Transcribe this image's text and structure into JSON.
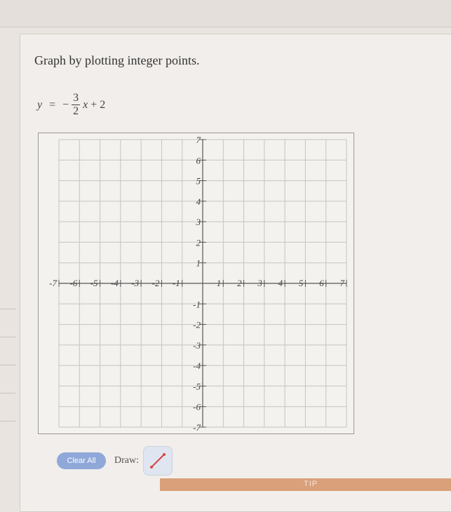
{
  "question": {
    "title": "Graph by plotting integer points.",
    "equation": {
      "lhs": "y",
      "equals": "=",
      "sign": "−",
      "numerator": "3",
      "denominator": "2",
      "variable": "x",
      "constant": "+ 2"
    }
  },
  "graph": {
    "x_ticks": [
      "-7",
      "-6",
      "-5",
      "-4",
      "-3",
      "-2",
      "-1",
      "1",
      "2",
      "3",
      "4",
      "5",
      "6",
      "7"
    ],
    "y_ticks": [
      "7",
      "6",
      "5",
      "4",
      "3",
      "2",
      "1",
      "-1",
      "-2",
      "-3",
      "-4",
      "-5",
      "-6",
      "-7"
    ],
    "range": {
      "xmin": -7,
      "xmax": 7,
      "ymin": -7,
      "ymax": 7
    },
    "grid": true
  },
  "controls": {
    "clear_all": "Clear All",
    "draw_label": "Draw:",
    "draw_tool_icon": "line-segment-icon"
  },
  "footer": {
    "tip": "TIP"
  },
  "colors": {
    "clear_button": "#8fa8d9",
    "tip_bar": "#d9a07a",
    "draw_tool_stroke": "#d64545"
  }
}
